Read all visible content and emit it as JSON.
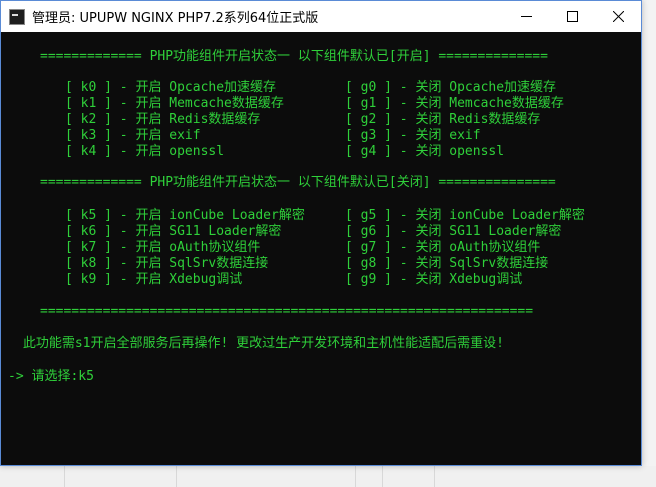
{
  "window": {
    "title": "管理员:  UPUPW NGINX PHP7.2系列64位正式版",
    "minimize": "—",
    "maximize": "☐",
    "close": "✕"
  },
  "console": {
    "header_on": "============= PHP功能组件开启状态一 以下组件默认已[开启] ==============",
    "on_rows": [
      {
        "left": "[ k0 ] - 开启 Opcache加速缓存",
        "right": "[ g0 ] - 关闭 Opcache加速缓存"
      },
      {
        "left": "[ k1 ] - 开启 Memcache数据缓存",
        "right": "[ g1 ] - 关闭 Memcache数据缓存"
      },
      {
        "left": "[ k2 ] - 开启 Redis数据缓存",
        "right": "[ g2 ] - 关闭 Redis数据缓存"
      },
      {
        "left": "[ k3 ] - 开启 exif",
        "right": "[ g3 ] - 关闭 exif"
      },
      {
        "left": "[ k4 ] - 开启 openssl",
        "right": "[ g4 ] - 关闭 openssl"
      }
    ],
    "header_off": "============= PHP功能组件开启状态一 以下组件默认已[关闭] ===============",
    "off_rows": [
      {
        "left": "[ k5 ] - 开启 ionCube Loader解密",
        "right": "[ g5 ] - 关闭 ionCube Loader解密"
      },
      {
        "left": "[ k6 ] - 开启 SG11 Loader解密",
        "right": "[ g6 ] - 关闭 SG11 Loader解密"
      },
      {
        "left": "[ k7 ] - 开启 oAuth协议组件",
        "right": "[ g7 ] - 关闭 oAuth协议组件"
      },
      {
        "left": "[ k8 ] - 开启 SqlSrv数据连接",
        "right": "[ g8 ] - 关闭 SqlSrv数据连接"
      },
      {
        "left": "[ k9 ] - 开启 Xdebug调试",
        "right": "[ g9 ] - 关闭 Xdebug调试"
      }
    ],
    "divider": "===============================================================",
    "notice": " 此功能需s1开启全部服务后再操作! 更改过生产开发环境和主机性能适配后需重设!",
    "prompt": "-> 请选择:k5",
    "text_color": "#2fd03a"
  }
}
